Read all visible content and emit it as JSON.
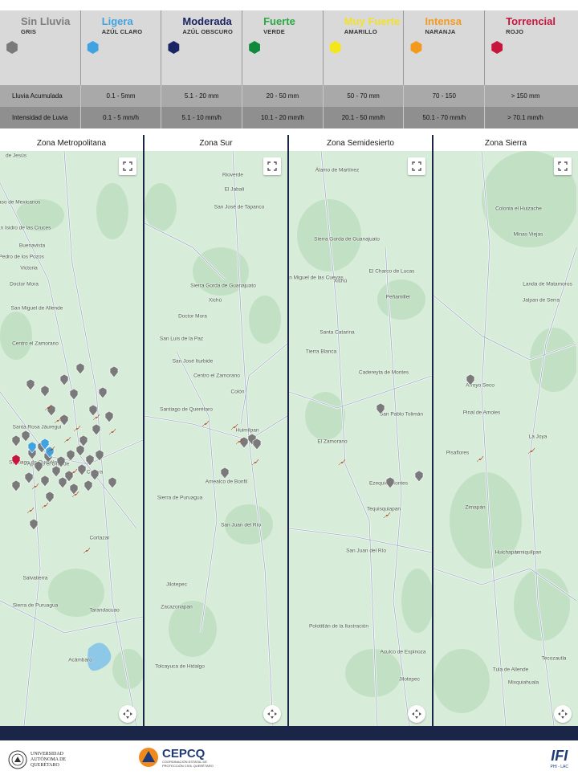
{
  "legend": {
    "categories": [
      {
        "name": "Sin Lluvia",
        "color_label": "GRIS",
        "hex": "#7a7a7a",
        "text_color": "#7d7d7d"
      },
      {
        "name": "Ligera",
        "color_label": "AZÚL CLARO",
        "hex": "#3ea3e0",
        "text_color": "#3ea3e0"
      },
      {
        "name": "Moderada",
        "color_label": "AZÚL OBSCURO",
        "hex": "#1b2462",
        "text_color": "#1b2462"
      },
      {
        "name": "Fuerte",
        "color_label": "VERDE",
        "hex": "#0f8a3a",
        "text_color": "#2aa844"
      },
      {
        "name": "Muy Fuerte",
        "color_label": "AMARILLO",
        "hex": "#f5e61a",
        "text_color": "#f2e12a"
      },
      {
        "name": "Intensa",
        "color_label": "NARANJA",
        "hex": "#f39a1e",
        "text_color": "#f39a1e"
      },
      {
        "name": "Torrencial",
        "color_label": "ROJO",
        "hex": "#c6163e",
        "text_color": "#c6163e"
      }
    ],
    "table": {
      "rows": [
        {
          "label": "Lluvia Acumulada",
          "values": [
            "0.1 - 5mm",
            "5.1 - 20 mm",
            "20 - 50 mm",
            "50 - 70 mm",
            "70 - 150",
            "> 150 mm"
          ]
        },
        {
          "label": "Intensidad de Luvia",
          "values": [
            "0.1 - 5 mm/h",
            "5.1 - 10 mm/h",
            "10.1 - 20 mm/h",
            "20.1 - 50 mm/h",
            "50.1 - 70 mm/h",
            "> 70.1 mm/h"
          ]
        }
      ]
    }
  },
  "zones": [
    {
      "title": "Zona Metropolitana",
      "labels": [
        {
          "text": "de Jesús"
        },
        {
          "text": "Paso de Mexicanos"
        },
        {
          "text": "San Isidro de las Cruces"
        },
        {
          "text": "Buenavista"
        },
        {
          "text": "San Pedro de los Pozos"
        },
        {
          "text": "Victoria"
        },
        {
          "text": "Doctor Mora"
        },
        {
          "text": "San Miguel de Allende"
        },
        {
          "text": "Centro el Zamorano"
        },
        {
          "text": "Santa Rosa Jáuregui"
        },
        {
          "text": "Santiago de Querétaro"
        },
        {
          "text": "Apaseo el Grande"
        },
        {
          "text": "Celaya"
        },
        {
          "text": "Cortazar"
        },
        {
          "text": "Salvatierra"
        },
        {
          "text": "Sierra de Puruagua"
        },
        {
          "text": "Tarandacuao"
        },
        {
          "text": "Acámbaro"
        }
      ]
    },
    {
      "title": "Zona Sur",
      "labels": [
        {
          "text": "Rioverde"
        },
        {
          "text": "El Jabali"
        },
        {
          "text": "San José de Tapanco"
        },
        {
          "text": "Sierra Gorda de Guanajuato"
        },
        {
          "text": "Xichú"
        },
        {
          "text": "Doctor Mora"
        },
        {
          "text": "San Luis de la Paz"
        },
        {
          "text": "San José Iturbide"
        },
        {
          "text": "Centro el Zamorano"
        },
        {
          "text": "Colón"
        },
        {
          "text": "Santiago de Querétaro"
        },
        {
          "text": "Huimilpan"
        },
        {
          "text": "Amealco de Bonfil"
        },
        {
          "text": "Sierra de Puruagua"
        },
        {
          "text": "San Juan del Río"
        },
        {
          "text": "Jilotepec"
        },
        {
          "text": "Zacazonapan"
        },
        {
          "text": "Tolcayuca de Hidalgo"
        }
      ]
    },
    {
      "title": "Zona Semidesierto",
      "labels": [
        {
          "text": "Álamo de Martínez"
        },
        {
          "text": "Sierra Gorda de Guanajuato"
        },
        {
          "text": "San Miguel de las Cuevas"
        },
        {
          "text": "Xichú"
        },
        {
          "text": "El Charco de Lucas"
        },
        {
          "text": "Peñamiller"
        },
        {
          "text": "Santa Catarina"
        },
        {
          "text": "Tierra Blanca"
        },
        {
          "text": "Cadereyta de Montes"
        },
        {
          "text": "San Pablo Tolimán"
        },
        {
          "text": "El Zamorano"
        },
        {
          "text": "Ezequiel Montes"
        },
        {
          "text": "Tequisquiapan"
        },
        {
          "text": "San Juan del Río"
        },
        {
          "text": "Polotitlán de la Ilustración"
        },
        {
          "text": "Aculco de Espinoza"
        },
        {
          "text": "Jilotepec"
        }
      ]
    },
    {
      "title": "Zona Sierra",
      "labels": [
        {
          "text": "Colonia el Huizache"
        },
        {
          "text": "Minas Viejas"
        },
        {
          "text": "Landa de Matamoros"
        },
        {
          "text": "Jalpan de Serra"
        },
        {
          "text": "Arroyo Seco"
        },
        {
          "text": "Pinal de Amoles"
        },
        {
          "text": "Pisaflores"
        },
        {
          "text": "La Joya"
        },
        {
          "text": "Zimapán"
        },
        {
          "text": "Ixmiquilpan"
        },
        {
          "text": "Tecozautla"
        },
        {
          "text": "Huichapan"
        },
        {
          "text": "Tula de Allende"
        },
        {
          "text": "Mixquiahuala"
        }
      ]
    }
  ],
  "footer": {
    "uaq_name": "UNIVERSIDAD AUTÓNOMA DE QUERÉTARO",
    "cepcq_name": "CEPCQ",
    "cepcq_subtitle": "COORDINACIÓN ESTATAL DE PROTECCIÓN CIVIL QUERÉTARO",
    "ifi_name": "IFI",
    "ifi_subtitle": "PHI - LAC"
  },
  "colors": {
    "accent_navy": "#1b2547",
    "map_bg": "#d7ecd9"
  }
}
